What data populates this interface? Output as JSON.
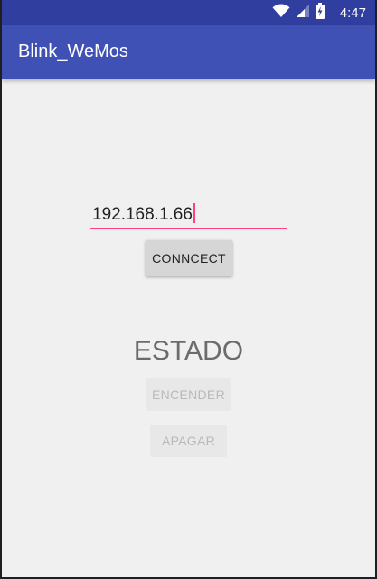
{
  "status_bar": {
    "time": "4:47",
    "icons": [
      "wifi-icon",
      "cell-signal-icon",
      "battery-charging-icon"
    ],
    "color": "#303f9f"
  },
  "app_bar": {
    "title": "Blink_WeMos",
    "color": "#3f51b5"
  },
  "main": {
    "ip_input": {
      "value": "192.168.1.66",
      "accent": "#ff4081"
    },
    "connect_button": "CONNCECT",
    "estado_label": "ESTADO",
    "encender_button": "ENCENDER",
    "apagar_button": "APAGAR"
  }
}
